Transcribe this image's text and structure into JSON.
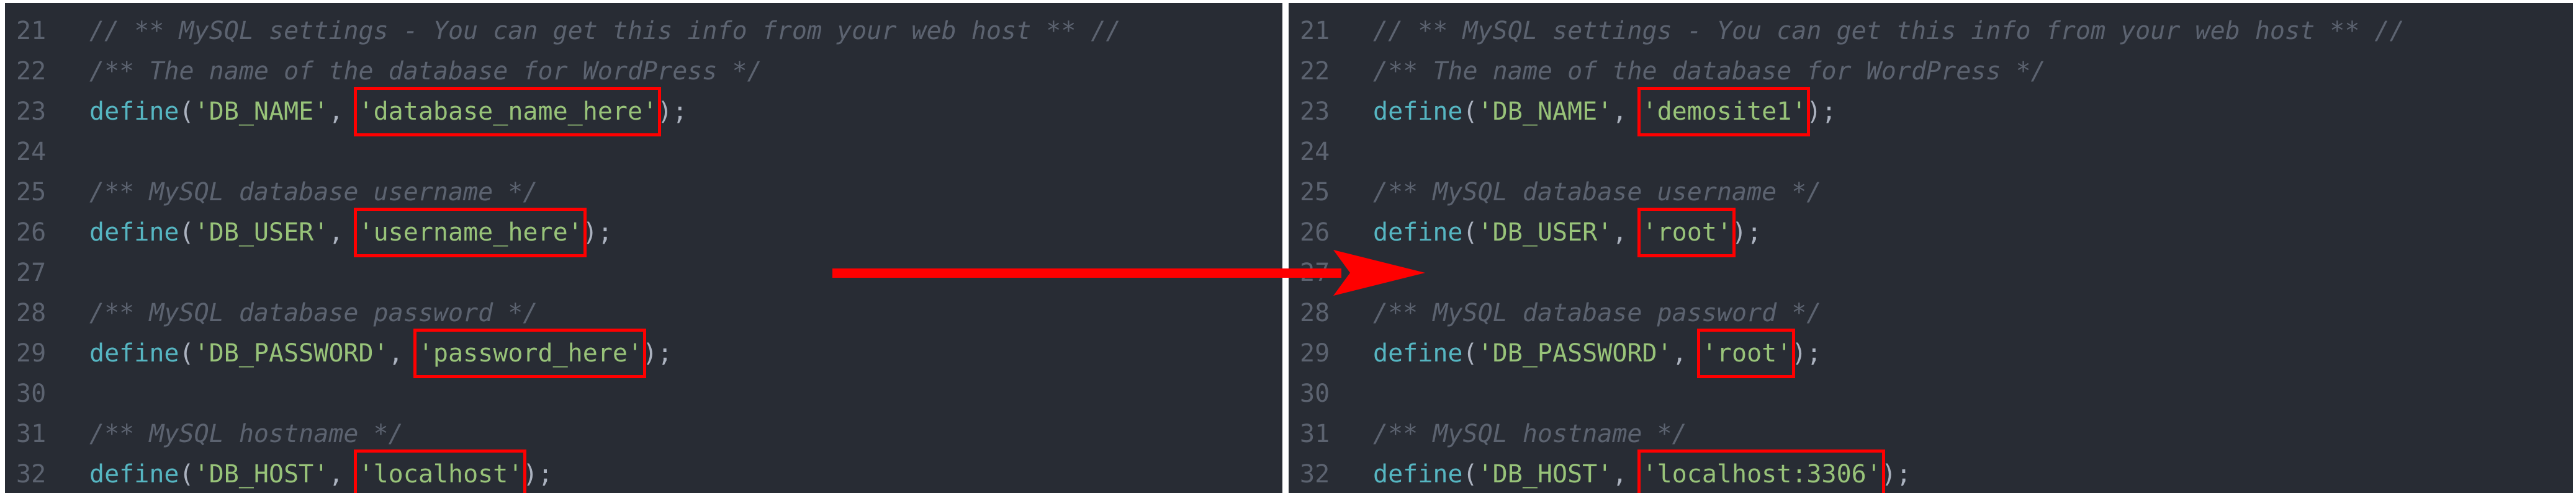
{
  "colors": {
    "background": "#282c34",
    "line_number": "#5c6370",
    "comment": "#5c6370",
    "function": "#56b6c2",
    "string": "#98c379",
    "punctuation": "#abb2bf",
    "highlight": "#ff0000",
    "arrow": "#ff0000"
  },
  "arrow_icon": "arrow-right-icon",
  "before": {
    "lines": [
      {
        "num": "21",
        "comment": "// ** MySQL settings - You can get this info from your web host ** //"
      },
      {
        "num": "22",
        "comment": "/** The name of the database for WordPress */"
      },
      {
        "num": "23",
        "fn": "define",
        "key": "'DB_NAME'",
        "value": "'database_name_here'"
      },
      {
        "num": "24"
      },
      {
        "num": "25",
        "comment": "/** MySQL database username */"
      },
      {
        "num": "26",
        "fn": "define",
        "key": "'DB_USER'",
        "value": "'username_here'"
      },
      {
        "num": "27"
      },
      {
        "num": "28",
        "comment": "/** MySQL database password */"
      },
      {
        "num": "29",
        "fn": "define",
        "key": "'DB_PASSWORD'",
        "value": "'password_here'"
      },
      {
        "num": "30"
      },
      {
        "num": "31",
        "comment": "/** MySQL hostname */"
      },
      {
        "num": "32",
        "fn": "define",
        "key": "'DB_HOST'",
        "value": "'localhost'"
      }
    ]
  },
  "after": {
    "lines": [
      {
        "num": "21",
        "comment": "// ** MySQL settings - You can get this info from your web host ** //"
      },
      {
        "num": "22",
        "comment": "/** The name of the database for WordPress */"
      },
      {
        "num": "23",
        "fn": "define",
        "key": "'DB_NAME'",
        "value": "'demosite1'"
      },
      {
        "num": "24"
      },
      {
        "num": "25",
        "comment": "/** MySQL database username */"
      },
      {
        "num": "26",
        "fn": "define",
        "key": "'DB_USER'",
        "value": "'root'"
      },
      {
        "num": "27"
      },
      {
        "num": "28",
        "comment": "/** MySQL database password */"
      },
      {
        "num": "29",
        "fn": "define",
        "key": "'DB_PASSWORD'",
        "value": "'root'"
      },
      {
        "num": "30"
      },
      {
        "num": "31",
        "comment": "/** MySQL hostname */"
      },
      {
        "num": "32",
        "fn": "define",
        "key": "'DB_HOST'",
        "value": "'localhost:3306'"
      }
    ]
  }
}
